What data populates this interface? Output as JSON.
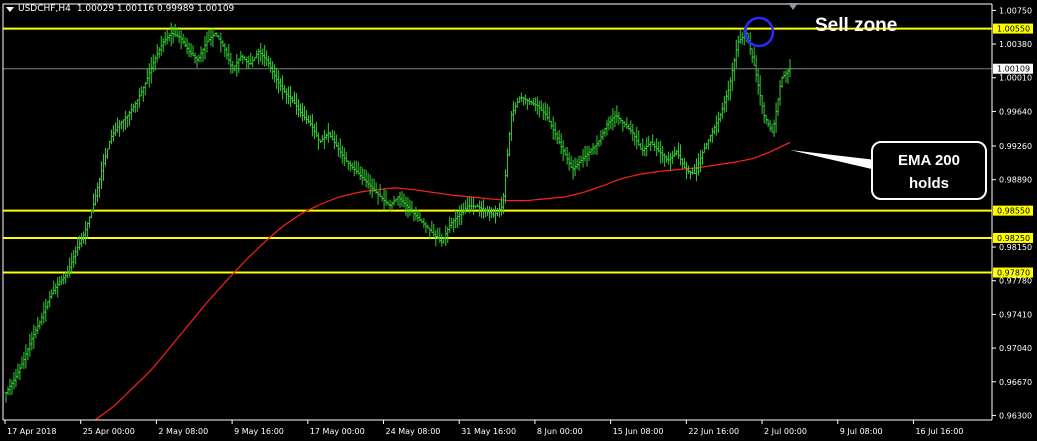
{
  "header": {
    "symbol": "USDCHF,H4",
    "ohlc": "1.00029 1.00116 0.99989 1.00109"
  },
  "annotations": {
    "sell_zone": "Sell zone",
    "ema_callout_line1": "EMA 200",
    "ema_callout_line2": "holds"
  },
  "colors": {
    "background": "#000000",
    "candle": "#33cc33",
    "ema": "#ff2020",
    "level_line": "#ffff00",
    "current_price_line": "#808080",
    "axis": "#ffffff",
    "circle": "#2a2aff"
  },
  "chart_data": {
    "type": "line",
    "title": "",
    "xlabel": "",
    "ylabel": "",
    "ylim": [
      0.9625,
      1.0082
    ],
    "y_ticks": [
      "1.00750",
      "1.00380",
      "1.00010",
      "0.99640",
      "0.99260",
      "0.98890",
      "0.98150",
      "0.97780",
      "0.97410",
      "0.97040",
      "0.96670",
      "0.96300"
    ],
    "x_tick_labels": [
      "17 Apr 2018",
      "25 Apr 00:00",
      "2 May 08:00",
      "9 May 16:00",
      "17 May 00:00",
      "24 May 08:00",
      "31 May 16:00",
      "8 Jun 00:00",
      "15 Jun 08:00",
      "22 Jun 16:00",
      "2 Jul 00:00",
      "9 Jul 08:00",
      "16 Jul 16:00"
    ],
    "levels": [
      {
        "label": "1.00550",
        "value": 1.0055
      },
      {
        "label": "0.98550",
        "value": 0.9855
      },
      {
        "label": "0.98250",
        "value": 0.9825
      },
      {
        "label": "0.97870",
        "value": 0.9787
      }
    ],
    "current_price": {
      "label": "1.00109",
      "value": 1.00109
    },
    "grid": false,
    "legend": "none",
    "series": [
      {
        "kind": "price",
        "values": [
          0.9655,
          0.967,
          0.969,
          0.9715,
          0.9735,
          0.976,
          0.9775,
          0.9785,
          0.981,
          0.983,
          0.986,
          0.99,
          0.9935,
          0.995,
          0.996,
          0.9975,
          0.9995,
          1.002,
          1.004,
          1.005,
          1.0045,
          1.003,
          1.002,
          1.004,
          1.005,
          1.0035,
          1.001,
          1.0025,
          1.0015,
          1.003,
          1.002,
          1.0,
          0.9985,
          0.9975,
          0.996,
          0.995,
          0.993,
          0.994,
          0.9925,
          0.991,
          0.99,
          0.989,
          0.988,
          0.987,
          0.986,
          0.987,
          0.986,
          0.985,
          0.984,
          0.983,
          0.982,
          0.984,
          0.985,
          0.986,
          0.986,
          0.9855,
          0.985,
          0.986,
          0.996,
          0.998,
          0.9975,
          0.997,
          0.996,
          0.994,
          0.992,
          0.99,
          0.991,
          0.992,
          0.993,
          0.995,
          0.996,
          0.995,
          0.994,
          0.992,
          0.993,
          0.992,
          0.991,
          0.992,
          0.99,
          0.9895,
          0.992,
          0.994,
          0.996,
          0.999,
          1.004,
          1.005,
          1.001,
          0.996,
          0.994,
          1.0,
          1.0011
        ]
      },
      {
        "kind": "EMA 200",
        "values": [
          0.9625,
          0.964,
          0.966,
          0.968,
          0.9705,
          0.973,
          0.9755,
          0.9778,
          0.98,
          0.982,
          0.9838,
          0.9852,
          0.9862,
          0.987,
          0.9875,
          0.9878,
          0.988,
          0.9878,
          0.9875,
          0.9872,
          0.987,
          0.9868,
          0.9866,
          0.9866,
          0.9868,
          0.987,
          0.9875,
          0.9882,
          0.989,
          0.9895,
          0.9898,
          0.99,
          0.9902,
          0.9905,
          0.9908,
          0.9912,
          0.992,
          0.993
        ]
      }
    ]
  }
}
